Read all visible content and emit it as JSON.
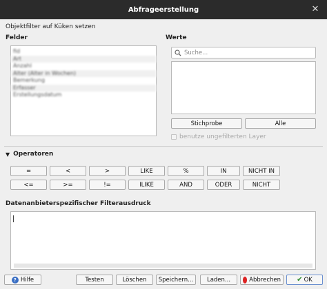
{
  "window": {
    "title": "Abfrageerstellung",
    "close": "✕"
  },
  "header": {
    "filter_label": "Objektfilter auf Küken setzen"
  },
  "fields": {
    "title": "Felder",
    "items": [
      "fid",
      "Art",
      "Anzahl",
      "Alter (Alter in Wochen)",
      "Bemerkung",
      "Erfasser",
      "Erstellungsdatum"
    ]
  },
  "values": {
    "title": "Werte",
    "search_placeholder": "Suche...",
    "sample_button": "Stichprobe",
    "all_button": "Alle",
    "unfiltered_checkbox": "benutze ungefilterten Layer"
  },
  "operators": {
    "title": "Operatoren",
    "row1": [
      "=",
      "<",
      ">",
      "LIKE",
      "%",
      "IN",
      "NICHT IN"
    ],
    "row2": [
      "<=",
      ">=",
      "!=",
      "ILIKE",
      "AND",
      "ODER",
      "NICHT"
    ]
  },
  "expression": {
    "title": "Datenanbieterspezifischer Filterausdruck"
  },
  "footer": {
    "help": "Hilfe",
    "test": "Testen",
    "clear": "Löschen",
    "save": "Speichern...",
    "load": "Laden...",
    "cancel": "Abbrechen",
    "ok": "OK"
  }
}
